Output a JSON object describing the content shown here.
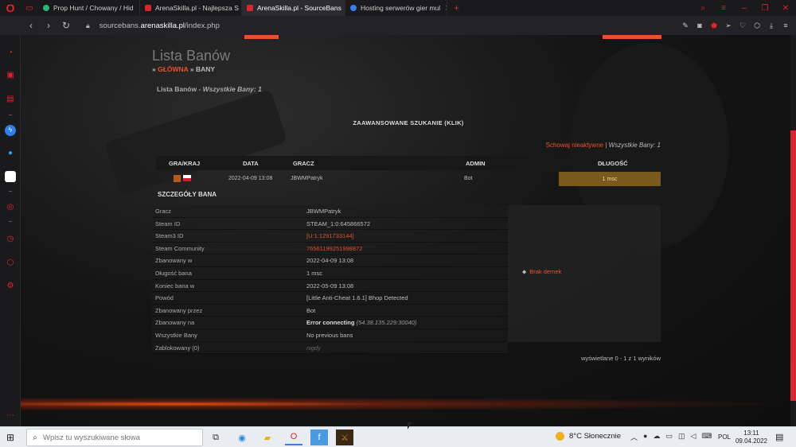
{
  "browser": {
    "tabs": [
      {
        "label": "Prop Hunt / Chowany / Hid",
        "color": "#2bb673"
      },
      {
        "label": "ArenaSkilla.pl - Najlepsza S",
        "color": "#d9262c"
      },
      {
        "label": "ArenaSkilla.pl - SourceBans",
        "color": "#d9262c"
      },
      {
        "label": "Hosting serwerów gier mul",
        "color": "#2f80ed"
      }
    ],
    "new_tab": "+",
    "close_glyph": "✕",
    "url_prefix": "sourcebans.",
    "url_domain": "arenaskilla.pl",
    "url_path": "/index.php"
  },
  "page": {
    "title": "Lista Banów",
    "breadcrumb_sep": "»",
    "breadcrumb_home": "GŁÓWNA",
    "breadcrumb_current": "BANY",
    "list_heading": "Lista Banów",
    "list_heading_sep": " - ",
    "list_heading_count": "Wszystkie Bany: 1",
    "advanced_search": "ZAAWANSOWANE SZUKANIE (KLIK)",
    "hide_inactive": "Schowaj nieaktywne",
    "hide_sep": " | ",
    "all_bans": "Wszystkie Bany: 1",
    "table_headers": {
      "game": "GRA/KRAJ",
      "date": "DATA",
      "player": "GRACZ",
      "admin": "ADMIN",
      "length": "DŁUGOŚĆ"
    },
    "ban_row": {
      "date": "2022-04-09 13:08",
      "player": "JBWMPatryk",
      "admin": "Bot",
      "length": "1 msc"
    },
    "details_title": "SZCZEGÓŁY BANA",
    "details": [
      {
        "key": "Gracz",
        "value": "JBWMPatryk"
      },
      {
        "key": "Steam ID",
        "value": "STEAM_1:0:645866572"
      },
      {
        "key": "Steam3 ID",
        "value": "[U:1:1291733144]"
      },
      {
        "key": "Steam Community",
        "value": "76561199251998872"
      },
      {
        "key": "Zbanowany w",
        "value": "2022-04-09 13:08"
      },
      {
        "key": "Długość bana",
        "value": "1 msc"
      },
      {
        "key": "Koniec bana w",
        "value": "2022-05-09 13:08"
      },
      {
        "key": "Powód",
        "value": "[Little Anti-Cheat 1.6.1] Bhop Detected"
      },
      {
        "key": "Zbanowany przez",
        "value": "Bot"
      },
      {
        "key": "Zbanowany na",
        "value": "Error connecting",
        "extra": "(54.38.135.229:30040)"
      },
      {
        "key": "Wszystkie Bany",
        "value": "No previous bans"
      },
      {
        "key": "Zablokowany (0)",
        "value": "nigdy"
      }
    ],
    "demo_link": "Brak demek",
    "pagination": "wyświetlane 0 - 1 z 1 wyników"
  },
  "taskbar": {
    "search_placeholder": "Wpisz tu wyszukiwane słowa",
    "weather": "8°C  Słonecznie",
    "lang": "POL",
    "time": "13:11",
    "date": "09.04.2022"
  },
  "colors": {
    "accent": "#e5532c",
    "opera_red": "#e5222c",
    "length_badge": "#7a5a1c"
  }
}
